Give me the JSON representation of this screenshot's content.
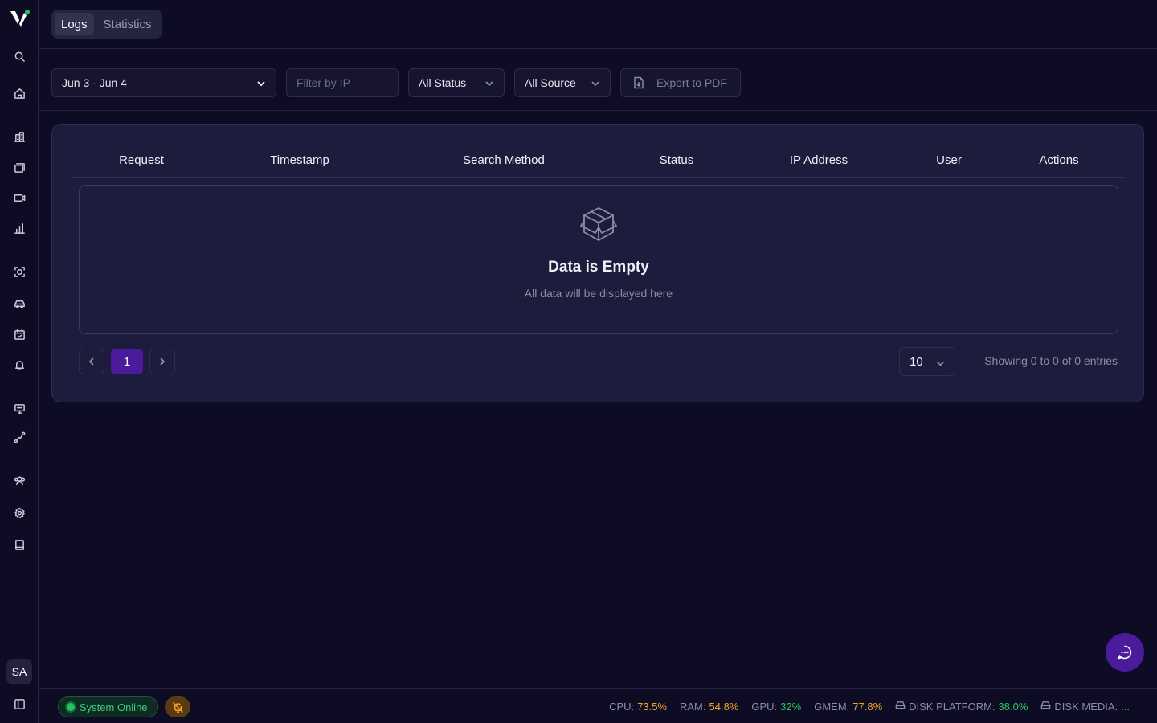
{
  "tabs": [
    {
      "label": "Logs",
      "active": true
    },
    {
      "label": "Statistics",
      "active": false
    }
  ],
  "filters": {
    "date_range": "Jun 3 - Jun 4",
    "ip_placeholder": "Filter by IP",
    "status": "All Status",
    "source": "All Source",
    "export_label": "Export to PDF"
  },
  "table": {
    "columns": [
      "Request",
      "Timestamp",
      "Search Method",
      "Status",
      "IP Address",
      "User",
      "Actions"
    ],
    "rows": []
  },
  "empty_state": {
    "title": "Data is Empty",
    "subtitle": "All data will be displayed here",
    "icon": "package-icon"
  },
  "pagination": {
    "current_page": "1",
    "page_size": "10",
    "entries_text": "Showing 0 to 0 of 0 entries"
  },
  "user": {
    "initials": "SA"
  },
  "status_bar": {
    "system_status": "System Online",
    "metrics": [
      {
        "label": "CPU:",
        "value": "73.5%",
        "color": "#f5a524"
      },
      {
        "label": "RAM:",
        "value": "54.8%",
        "color": "#f5a524"
      },
      {
        "label": "GPU:",
        "value": "32%",
        "color": "#22c55e"
      },
      {
        "label": "GMEM:",
        "value": "77.8%",
        "color": "#f5a524"
      },
      {
        "label": "DISK PLATFORM:",
        "value": "38.0%",
        "color": "#22c55e"
      },
      {
        "label": "DISK MEDIA:",
        "value": "...",
        "color": "#22c55e"
      }
    ]
  },
  "colors": {
    "background": "#0e0c24",
    "card": "#1d1c3c",
    "accent": "#4a1b9a",
    "online_green": "#22c55e",
    "warn_amber": "#f5a524"
  },
  "sidebar_icons": [
    "search-icon",
    "home-icon",
    "building-icon",
    "layers-icon",
    "video-icon",
    "bar-chart-icon",
    "face-scan-icon",
    "car-icon",
    "calendar-icon",
    "bell-icon",
    "monitor-icon",
    "route-icon",
    "users-icon",
    "settings-icon",
    "book-icon"
  ]
}
